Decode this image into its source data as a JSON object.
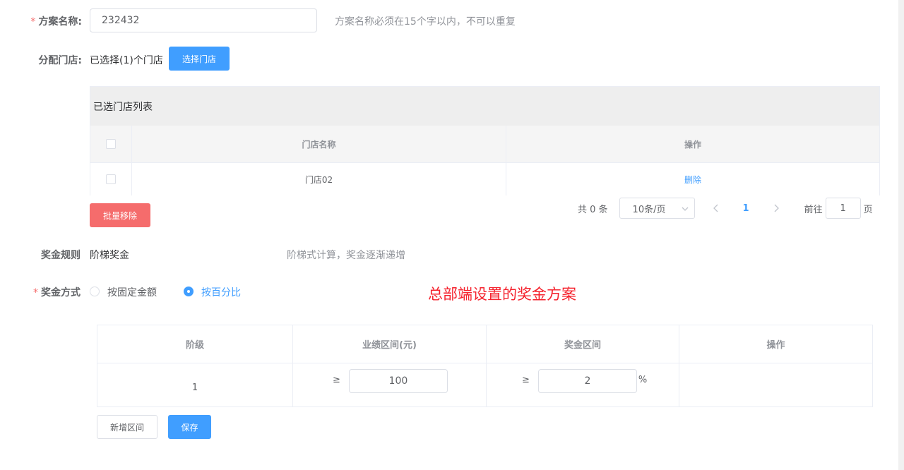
{
  "plan_name": {
    "label": "方案名称:",
    "value": "232432",
    "hint": "方案名称必须在15个字以内，不可以重复"
  },
  "store_assign": {
    "label": "分配门店:",
    "selected_text": "已选择(1)个门店",
    "select_button": "选择门店"
  },
  "store_list": {
    "title": "已选门店列表",
    "columns": [
      "门店名称",
      "操作"
    ],
    "rows": [
      {
        "name": "门店02",
        "action": "删除"
      }
    ],
    "batch_remove": "批量移除"
  },
  "pagination": {
    "total": "共 0 条",
    "page_size": "10条/页",
    "current_page": "1",
    "goto_label": "前往",
    "goto_value": "1",
    "page_suffix": "页"
  },
  "bonus_rule": {
    "label": "奖金规则",
    "value": "阶梯奖金",
    "hint": "阶梯式计算，奖金逐渐递增"
  },
  "bonus_method": {
    "label": "奖金方式",
    "options": [
      "按固定金额",
      "按百分比"
    ],
    "selected": "按百分比"
  },
  "annotation": "总部端设置的奖金方案",
  "bonus_table": {
    "columns": [
      "阶级",
      "业绩区间(元)",
      "奖金区间",
      "操作"
    ],
    "rows": [
      {
        "level": "1",
        "ge1": "≥",
        "performance": "100",
        "ge2": "≥",
        "bonus": "2",
        "unit": "%"
      }
    ]
  },
  "actions": {
    "add_range": "新增区间",
    "save": "保存"
  },
  "colors": {
    "primary": "#409eff",
    "danger": "#f56c6c",
    "annotation": "#f5222d"
  }
}
